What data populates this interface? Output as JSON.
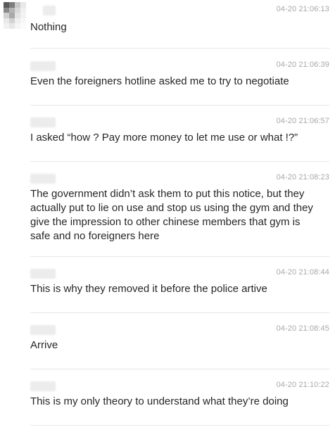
{
  "messages": [
    {
      "time": "04-20 21:06:13",
      "text": "Nothing"
    },
    {
      "time": "04-20 21:06:39",
      "text": "Even the foreigners hotline asked me to try to negotiate"
    },
    {
      "time": "04-20 21:06:57",
      "text": "I asked “how ? Pay more money to let me use or what !?”"
    },
    {
      "time": "04-20 21:08:23",
      "text": "The government didn’t ask them to put this notice, but they actually put to lie on use and stop us using the gym and they give the impression to other chinese members that gym is safe and no foreigners here"
    },
    {
      "time": "04-20 21:08:44",
      "text": "This is why they removed it before the police artive"
    },
    {
      "time": "04-20 21:08:45",
      "text": "Arrive"
    },
    {
      "time": "04-20 21:10:22",
      "text": "This is my only theory to understand what they’re doing"
    }
  ]
}
